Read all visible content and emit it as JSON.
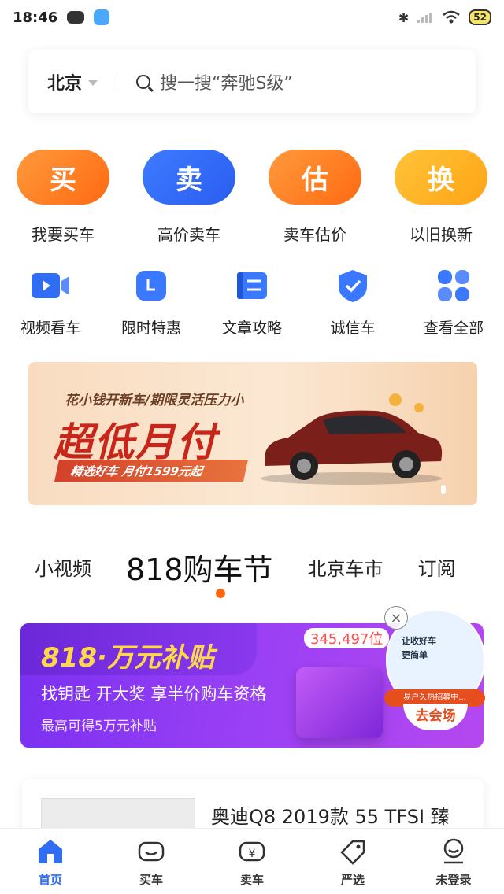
{
  "status_bar": {
    "time": "18:46",
    "battery": "52"
  },
  "search": {
    "city": "北京",
    "placeholder": "搜一搜“奔驰S级”"
  },
  "big_actions": [
    {
      "icon_text": "买",
      "label": "我要买车",
      "color_from": "#ff9a3c",
      "color_to": "#ff6a12"
    },
    {
      "icon_text": "卖",
      "label": "高价卖车",
      "color_from": "#3e7bff",
      "color_to": "#2a5df0"
    },
    {
      "icon_text": "估",
      "label": "卖车估价",
      "color_from": "#ff9a3c",
      "color_to": "#ff6a12"
    },
    {
      "icon_text": "换",
      "label": "以旧换新",
      "color_from": "#ffc43a",
      "color_to": "#ffa414"
    }
  ],
  "small_actions": [
    {
      "label": "视频看车",
      "icon": "video-icon"
    },
    {
      "label": "限时特惠",
      "icon": "clock-icon"
    },
    {
      "label": "文章攻略",
      "icon": "article-icon"
    },
    {
      "label": "诚信车",
      "icon": "shield-check-icon"
    },
    {
      "label": "查看全部",
      "icon": "grid-icon"
    }
  ],
  "banner": {
    "tagline": "花小钱开新车/期限灵活压力小",
    "title": "超低月付",
    "strip": "精选好车  月付1599元起"
  },
  "tabs": [
    "小视频",
    "818购车节",
    "北京车市",
    "订阅"
  ],
  "active_tab": 1,
  "promo": {
    "title": "818·万元补贴",
    "count": "345,497位",
    "line1": "找钥匙 开大奖 享半价购车资格",
    "line2": "最高可得5万元补贴"
  },
  "float_ad": {
    "text1": "让收好车",
    "text2": "更简单",
    "strip": "易户久热招募中...",
    "button": "去会场"
  },
  "listing": {
    "title": "奥迪Q8 2019款 55 TFSI 臻"
  },
  "bottom_nav": [
    {
      "label": "首页",
      "icon": "home-icon"
    },
    {
      "label": "买车",
      "icon": "buy-car-icon"
    },
    {
      "label": "卖车",
      "icon": "sell-car-icon"
    },
    {
      "label": "严选",
      "icon": "tag-icon"
    },
    {
      "label": "未登录",
      "icon": "user-icon"
    }
  ],
  "colors": {
    "accent_blue": "#2f6df5",
    "accent_orange": "#ff6a10"
  }
}
